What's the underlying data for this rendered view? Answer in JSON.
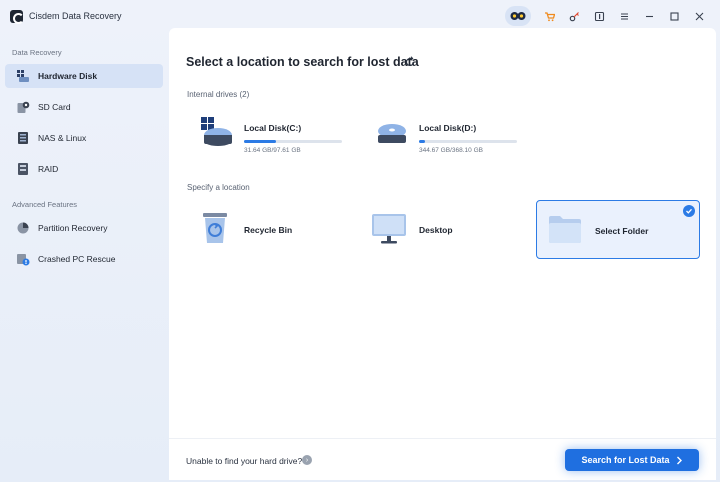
{
  "window": {
    "title": "Cisdem Data Recovery"
  },
  "colors": {
    "accent": "#1f6fe0",
    "sidebar_active": "#d6e2f6",
    "selected_border": "#2c7be5"
  },
  "titlebar_icons": [
    "avatar-icon",
    "cart-icon",
    "key-icon",
    "info-icon",
    "menu-icon",
    "minimize-icon",
    "maximize-icon",
    "close-icon"
  ],
  "sidebar": {
    "section_recovery": "Data Recovery",
    "section_advanced": "Advanced Features",
    "items": [
      {
        "label": "Hardware Disk",
        "icon": "hardware-disk-icon",
        "active": true
      },
      {
        "label": "SD Card",
        "icon": "sd-card-icon",
        "active": false
      },
      {
        "label": "NAS & Linux",
        "icon": "nas-icon",
        "active": false
      },
      {
        "label": "RAID",
        "icon": "raid-icon",
        "active": false
      }
    ],
    "advanced_items": [
      {
        "label": "Partition Recovery",
        "icon": "partition-icon"
      },
      {
        "label": "Crashed PC Rescue",
        "icon": "crashed-pc-icon"
      }
    ]
  },
  "main": {
    "title": "Select a location to search for lost data",
    "internal_label": "Internal drives (2)",
    "drives": [
      {
        "name": "Local Disk(C:)",
        "size": "31.64 GB/97.61 GB",
        "used_fraction": 0.324
      },
      {
        "name": "Local Disk(D:)",
        "size": "344.67 GB/368.10 GB",
        "used_fraction": 0.06
      }
    ],
    "location_label": "Specify a location",
    "locations": [
      {
        "name": "Recycle Bin",
        "icon": "recycle-bin-icon",
        "selected": false
      },
      {
        "name": "Desktop",
        "icon": "desktop-icon",
        "selected": false
      },
      {
        "name": "Select Folder",
        "icon": "folder-icon",
        "selected": true
      }
    ]
  },
  "footer": {
    "help_text": "Unable to find your hard drive?",
    "search_label": "Search for Lost Data"
  }
}
